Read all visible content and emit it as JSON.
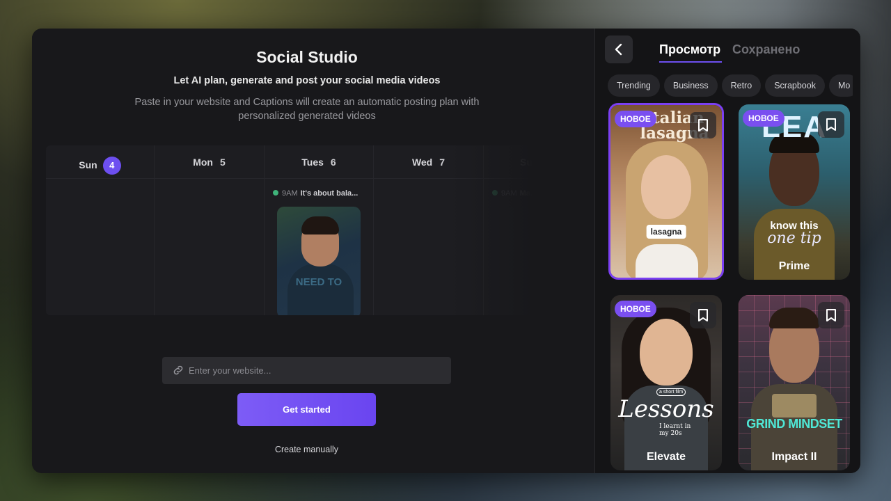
{
  "studio": {
    "title": "Social Studio",
    "subtitle": "Let AI plan, generate and post your social media videos",
    "description": "Paste in your website and Captions will create an automatic posting plan with personalized generated videos"
  },
  "calendar": {
    "days": [
      {
        "name": "Sun",
        "num": "4"
      },
      {
        "name": "Mon",
        "num": "5"
      },
      {
        "name": "Tues",
        "num": "6"
      },
      {
        "name": "Wed",
        "num": "7"
      },
      {
        "name": "Sun",
        "num": ""
      }
    ],
    "events": [
      {
        "time": "9AM",
        "title": "It's about bala...",
        "thumb_caption": "NEED TO"
      },
      {
        "time": "9AM",
        "title": "Ma..."
      }
    ]
  },
  "website_input": {
    "placeholder": "Enter your website...",
    "value": ""
  },
  "get_started_label": "Get started",
  "create_manually_label": "Create manually",
  "panel": {
    "tabs": {
      "active": "Просмотр",
      "inactive": "Сохранено"
    },
    "chips": [
      "Trending",
      "Business",
      "Retro",
      "Scrapbook",
      "Mo"
    ],
    "new_badge": "НОВОЕ",
    "cards": [
      {
        "name": "",
        "overlay_title": "Italian lasagna",
        "caption": "lasagna",
        "selected": true
      },
      {
        "name": "Prime",
        "overlay_title": "LEA",
        "caption_line1": "know this",
        "caption_line2": "one tip",
        "selected": false
      },
      {
        "name": "Elevate",
        "overlay_small": "a short film",
        "overlay_title": "Lessons",
        "overlay_sub1": "I learnt in",
        "overlay_sub2": "my 20s",
        "selected": false
      },
      {
        "name": "Impact II",
        "overlay_title": "GRIND MINDSET",
        "selected": false
      }
    ]
  },
  "colors": {
    "accent": "#6d4ff0",
    "badge": "#7a4ff0",
    "selected_border": "#7b3ff2",
    "event_dot": "#3fb37a"
  }
}
